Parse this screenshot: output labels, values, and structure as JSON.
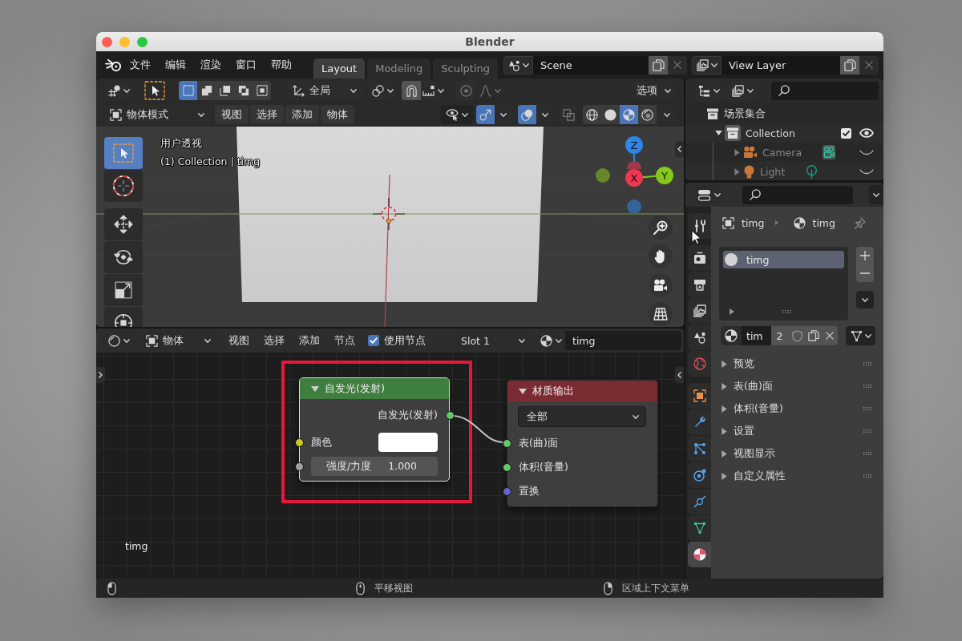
{
  "window": {
    "title": "Blender"
  },
  "top_bar": {
    "menus": [
      "文件",
      "编辑",
      "渲染",
      "窗口",
      "帮助"
    ],
    "workspaces": [
      {
        "label": "Layout",
        "selected": true
      },
      {
        "label": "Modeling",
        "selected": false
      },
      {
        "label": "Sculpting",
        "selected": false
      }
    ],
    "scene": "Scene",
    "view_layer": "View Layer"
  },
  "viewport": {
    "tool_header": {
      "select_modes": [
        {
          "kind": "set",
          "selected": true
        },
        {
          "kind": "extend",
          "selected": false
        },
        {
          "kind": "subtract",
          "selected": false
        },
        {
          "kind": "difference",
          "selected": false
        },
        {
          "kind": "intersect",
          "selected": false
        }
      ],
      "orientation": "全局",
      "snap": {
        "on": false
      },
      "proportional": {
        "on": false
      },
      "options": "选项"
    },
    "header": {
      "mode": "物体模式",
      "menus": [
        "视图",
        "选择",
        "添加",
        "物体"
      ],
      "toggles": [
        {
          "kind": "gizmos",
          "on": true
        },
        {
          "kind": "overlays",
          "on": true
        },
        {
          "kind": "xray",
          "on": false
        }
      ],
      "shading": [
        {
          "kind": "wireframe",
          "selected": false
        },
        {
          "kind": "solid",
          "selected": false
        },
        {
          "kind": "material",
          "selected": true
        },
        {
          "kind": "rendered",
          "selected": false
        }
      ]
    },
    "tools": [
      {
        "kind": "select",
        "selected": true
      },
      {
        "kind": "cursor",
        "selected": false
      },
      {
        "kind": "move",
        "selected": false
      },
      {
        "kind": "rotate",
        "selected": false
      },
      {
        "kind": "scale",
        "selected": false
      },
      {
        "kind": "transform",
        "selected": false
      }
    ],
    "view_name": "用户透视",
    "object_info": "(1) Collection | timg",
    "gizmo_axes": [
      {
        "label": "Z",
        "color": "#2e86e8"
      },
      {
        "label": "Y",
        "color": "#84c81c"
      },
      {
        "label": "X",
        "color": "#f03752"
      }
    ]
  },
  "node_editor": {
    "header": {
      "shader_type": "物体",
      "menus": [
        "视图",
        "选择",
        "添加",
        "节点"
      ],
      "use_nodes": {
        "label": "使用节点",
        "checked": true
      },
      "slot": "Slot 1",
      "material": "timg"
    },
    "nodes": [
      {
        "kind": "emission",
        "title": "自发光(发射)",
        "color": "#3e7e3e",
        "selected": true,
        "outputs": [
          {
            "label": "自发光(发射)",
            "color": "#63c763"
          }
        ],
        "inputs": [
          {
            "kind": "color",
            "label": "颜色",
            "color": "#c7c729",
            "swatch": {
              "color": "#ffffff"
            }
          },
          {
            "kind": "value",
            "label": "强度/力度",
            "value": "1.000",
            "color": "#a1a1a1"
          }
        ]
      },
      {
        "kind": "output",
        "title": "材质输出",
        "color": "#7b2c33",
        "selected": false,
        "target": "全部",
        "inputs": [
          {
            "kind": "shader",
            "label": "表(曲)面",
            "color": "#63c763"
          },
          {
            "kind": "shader",
            "label": "体积(音量)",
            "color": "#63c763"
          },
          {
            "kind": "vector",
            "label": "置换",
            "color": "#6363c7"
          }
        ]
      }
    ],
    "material_label": "timg"
  },
  "outliner": {
    "tree": [
      {
        "label": "场景集合",
        "kind": "scene_collection",
        "children": [
          {
            "label": "Collection",
            "kind": "collection",
            "expanded": true,
            "checked": true,
            "visible": true,
            "children": [
              {
                "label": "Camera",
                "kind": "camera",
                "expanded": false,
                "visible": false
              },
              {
                "label": "Light",
                "kind": "light",
                "expanded": false,
                "visible": false
              }
            ]
          }
        ]
      }
    ]
  },
  "properties": {
    "tabs": [
      {
        "kind": "tool",
        "selected": false
      },
      {
        "kind": "render",
        "selected": false
      },
      {
        "kind": "output",
        "selected": false
      },
      {
        "kind": "view_layer",
        "selected": false
      },
      {
        "kind": "scene",
        "selected": false
      },
      {
        "kind": "world",
        "selected": false
      },
      {
        "kind": "object",
        "selected": false
      },
      {
        "kind": "modifiers",
        "selected": false
      },
      {
        "kind": "particles",
        "selected": false
      },
      {
        "kind": "physics",
        "selected": false
      },
      {
        "kind": "constraints",
        "selected": false
      },
      {
        "kind": "data",
        "selected": false
      },
      {
        "kind": "material",
        "selected": true
      }
    ],
    "breadcrumb": [
      {
        "kind": "object",
        "label": "timg"
      },
      {
        "kind": "material",
        "label": "timg"
      }
    ],
    "material_slots": [
      {
        "label": "timg",
        "selected": true
      }
    ],
    "material": {
      "name": "tim",
      "users": "2"
    },
    "panels": [
      {
        "label": "预览",
        "expanded": false
      },
      {
        "label": "表(曲)面",
        "expanded": false
      },
      {
        "label": "体积(音量)",
        "expanded": false
      },
      {
        "label": "设置",
        "expanded": false
      },
      {
        "label": "视图显示",
        "expanded": false
      },
      {
        "label": "自定义属性",
        "expanded": false
      }
    ]
  },
  "status_bar": {
    "hints": [
      {
        "kind": "left"
      },
      {
        "kind": "middle",
        "label": "平移视图"
      },
      {
        "kind": "right",
        "label": "区域上下文菜单"
      }
    ]
  }
}
